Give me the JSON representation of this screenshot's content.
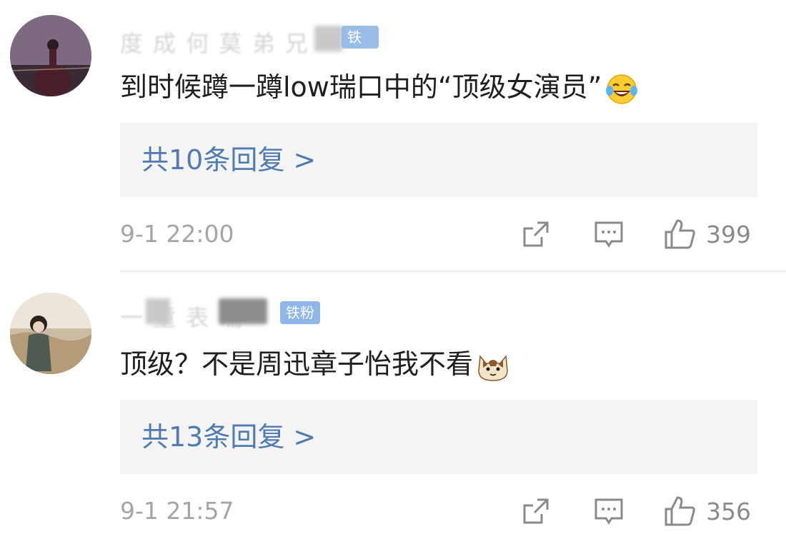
{
  "comments": [
    {
      "username": "度   成 何 莫 弟 兄",
      "badge": "铁粉",
      "text": "到时候蹲一蹲low瑞口中的“顶级女演员”",
      "emoji_icon": "laughing-tears-emoji",
      "replies_label": "共10条回复 >",
      "time": "9-1 22:00",
      "likes": "399"
    },
    {
      "username": "一   童 表 瑞",
      "badge": "铁粉",
      "text": "顶级？不是周迅章子怡我不看",
      "emoji_icon": "cat-face-emoji",
      "replies_label": "共13条回复 >",
      "time": "9-1 21:57",
      "likes": "356"
    }
  ],
  "colors": {
    "reply_link": "#4f7ab2",
    "reply_bg": "#f4f4f4",
    "badge_bg": "#8fb6e8",
    "meta_gray": "#a5a5a5"
  }
}
